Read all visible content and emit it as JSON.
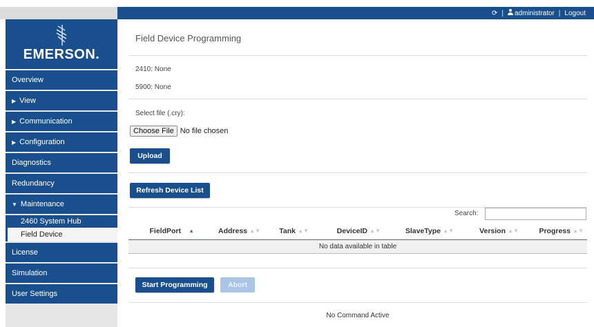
{
  "topbar": {
    "refresh_icon": "refresh-icon",
    "user_icon": "user-icon",
    "user_name": "administrator",
    "logout_label": "Logout"
  },
  "sidebar": {
    "brand": "EMERSON.",
    "items": [
      {
        "label": "Overview"
      },
      {
        "label": "View",
        "expandable": true
      },
      {
        "label": "Communication",
        "expandable": true
      },
      {
        "label": "Configuration",
        "expandable": true
      },
      {
        "label": "Diagnostics"
      },
      {
        "label": "Redundancy"
      },
      {
        "label": "Maintenance",
        "expanded": true
      }
    ],
    "subitems": [
      {
        "label": "2460 System Hub"
      },
      {
        "label": "Field Device",
        "active": true
      }
    ],
    "items_after": [
      {
        "label": "License"
      },
      {
        "label": "Simulation"
      },
      {
        "label": "User Settings"
      }
    ],
    "accent_color": "#1a4f8e"
  },
  "main": {
    "title": "Field Device Programming",
    "info_2410": "2410: None",
    "info_5900": "5900: None",
    "select_file_label": "Select file (.cry):",
    "choose_file_label": "Choose File",
    "no_file_label": "No file chosen",
    "upload_label": "Upload",
    "refresh_list_label": "Refresh Device List",
    "search_label": "Search:",
    "search_value": "",
    "table": {
      "columns": [
        "FieldPort",
        "Address",
        "Tank",
        "DeviceID",
        "SlaveType",
        "Version",
        "Progress"
      ],
      "sorted_column": "FieldPort",
      "empty_message": "No data available in table"
    },
    "start_label": "Start Programming",
    "abort_label": "Abort",
    "status_text": "No Command Active"
  }
}
